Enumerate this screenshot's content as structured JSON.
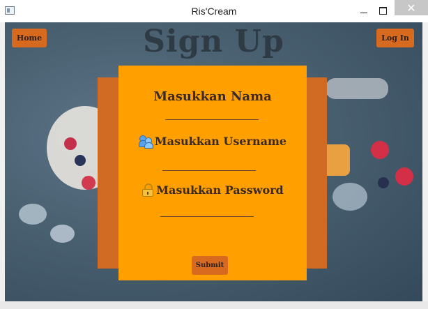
{
  "window": {
    "title": "Ris'Cream",
    "minimize": "",
    "maximize": "",
    "close": "✕"
  },
  "page": {
    "heading": "Sign Up",
    "home_label": "Home",
    "login_label": "Log In"
  },
  "form": {
    "name_label": "Masukkan Nama",
    "username_label": "Masukkan Username",
    "password_label": "Masukkan Password",
    "submit_label": "Submit"
  },
  "icons": {
    "username": "users-icon",
    "password": "lock-icon"
  },
  "colors": {
    "panel": "#ff9f00",
    "panel_back": "#d16a22",
    "button": "#d86a1f",
    "background": "#4b6273"
  }
}
